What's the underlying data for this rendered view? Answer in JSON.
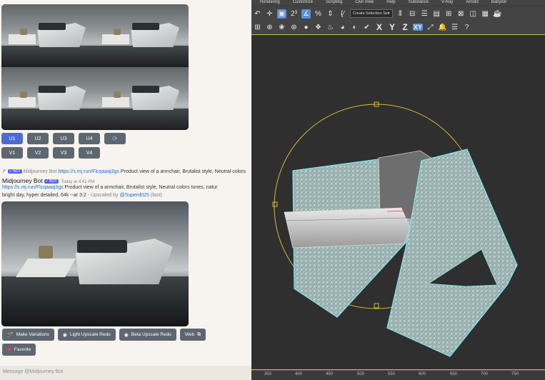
{
  "discord": {
    "upscale_buttons": [
      "U1",
      "U2",
      "U3",
      "U4"
    ],
    "variation_buttons": [
      "V1",
      "V2",
      "V3",
      "V4"
    ],
    "reroll_icon": "refresh-icon",
    "ref_line": {
      "badge": "✓ BOT",
      "bot": "Midjourney Bot",
      "link": "https://s.mj.run/Flcqaaaj3gs",
      "prompt": "Product view of a armchair, Brutalist style, Neutral colors"
    },
    "message": {
      "author": "Midjourney Bot",
      "badge": "✓ BOT",
      "time": "Today at 4:41 PM",
      "line1_link": "https://s.mj.run/Flcqaaaj3gs",
      "line1_text": "Product view of a armchair, Brutalist style, Neutral colors tones, natur",
      "line2_text": "bright day, hyper detailed, 64k --ar 3:2",
      "line2_sep": " - Upscaled by ",
      "mention": "@Superd025",
      "suffix": "(fast)"
    },
    "actions": [
      {
        "icon": "🪄",
        "label": "Make Variations"
      },
      {
        "icon": "◉",
        "label": "Light Upscale Redo"
      },
      {
        "icon": "◉",
        "label": "Beta Upscale Redo"
      },
      {
        "icon": "⧉",
        "label": "Web"
      }
    ],
    "favorite": {
      "icon": "❤",
      "label": "Favorite"
    },
    "input_placeholder": "Message @Midjourney Bot"
  },
  "max": {
    "menu": [
      "Rendering",
      "Customize",
      "Scripting",
      "Civil View",
      "Help",
      "Substance",
      "V-Ray",
      "Arnold",
      "Babylon"
    ],
    "selection_set": "Create Selection Se",
    "axes": [
      "X",
      "Y",
      "Z",
      "XY"
    ],
    "ruler": [
      "350",
      "400",
      "450",
      "500",
      "550",
      "600",
      "650",
      "700",
      "750"
    ]
  },
  "colors": {
    "accent": "#4e6ad6",
    "gizmo": "#d6b93c",
    "selection": "#7fe8f0"
  }
}
